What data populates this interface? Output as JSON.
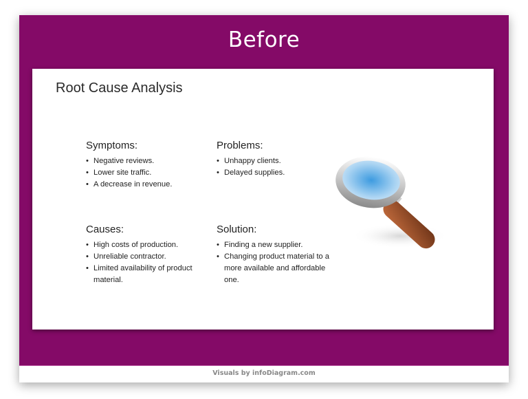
{
  "header": {
    "title": "Before"
  },
  "card": {
    "title": "Root Cause Analysis",
    "sections": [
      {
        "heading": "Symptoms:",
        "items": [
          "Negative reviews.",
          "Lower site traffic.",
          "A decrease in revenue."
        ]
      },
      {
        "heading": "Problems:",
        "items": [
          "Unhappy clients.",
          "Delayed supplies."
        ]
      },
      {
        "heading": "Causes:",
        "items": [
          "High costs of production.",
          "Unreliable contractor.",
          "Limited availability of product material."
        ]
      },
      {
        "heading": "Solution:",
        "items": [
          "Finding a new supplier.",
          "Changing product material to a more available and affordable one."
        ]
      }
    ],
    "illustration": "magnifying-glass-icon"
  },
  "footer": {
    "credit": "Visuals by infoDiagram.com"
  },
  "colors": {
    "band": "#840a67",
    "card": "#ffffff",
    "lens": "#7fb8e8",
    "handle": "#8b4a2a"
  }
}
